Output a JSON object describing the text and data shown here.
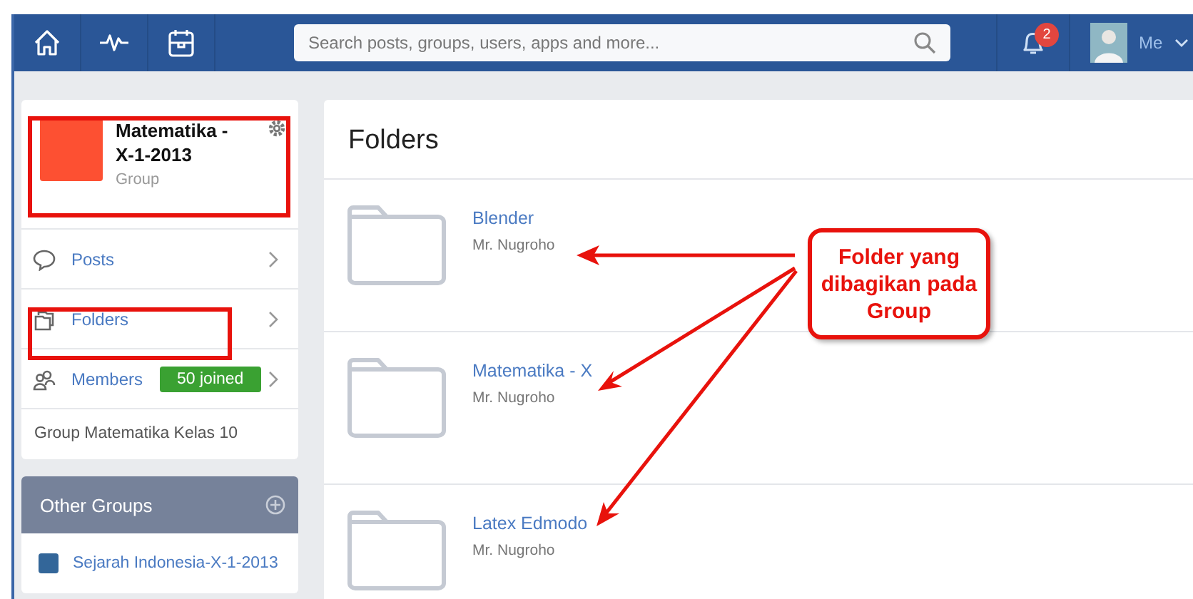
{
  "topbar": {
    "search": {
      "placeholder": "Search posts, groups, users, apps and more..."
    },
    "notifications": {
      "count": "2"
    },
    "user": {
      "label": "Me"
    }
  },
  "group": {
    "name": "Matematika - X-1-2013",
    "type": "Group",
    "description": "Group Matematika Kelas 10",
    "nav": [
      {
        "kind": "posts",
        "label": "Posts"
      },
      {
        "kind": "folders",
        "label": "Folders"
      },
      {
        "kind": "members",
        "label": "Members",
        "badge": "50 joined"
      }
    ]
  },
  "other_groups": {
    "title": "Other Groups",
    "items": [
      {
        "label": "Sejarah Indonesia-X-1-2013",
        "color": "#336699"
      }
    ]
  },
  "folders": {
    "title": "Folders",
    "items": [
      {
        "name": "Blender",
        "owner": "Mr. Nugroho"
      },
      {
        "name": "Matematika - X",
        "owner": "Mr. Nugroho"
      },
      {
        "name": "Latex Edmodo",
        "owner": "Mr. Nugroho"
      }
    ]
  },
  "annotation": {
    "callout": "Folder yang dibagikan pada Group"
  }
}
